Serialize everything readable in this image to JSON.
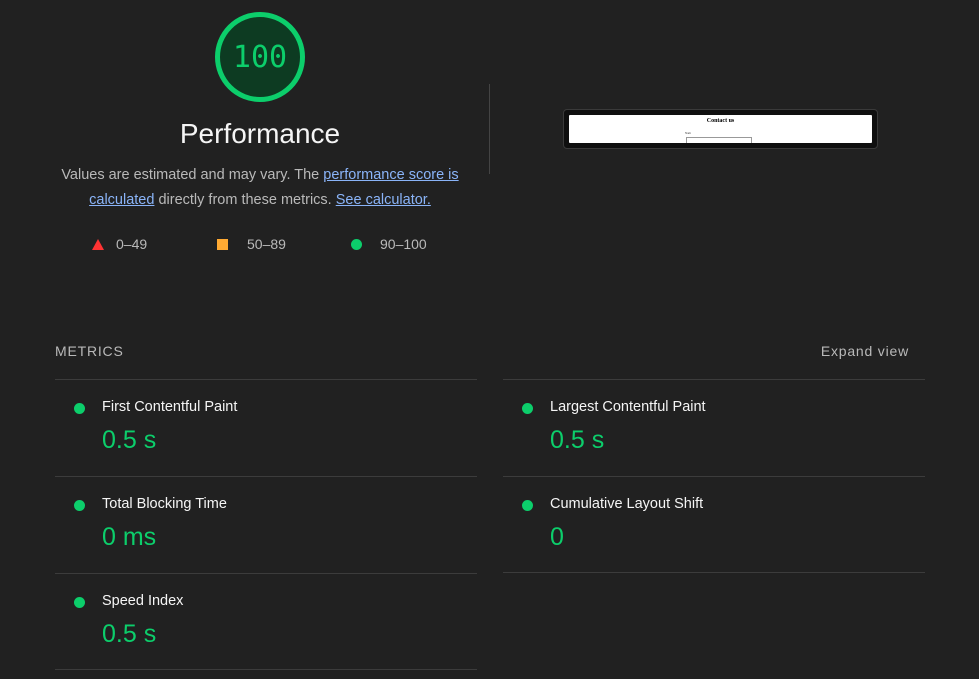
{
  "score": {
    "value": "100",
    "color": "#0cce6b"
  },
  "title": "Performance",
  "description": {
    "prefix": "Values are estimated and may vary. The ",
    "link1": "performance score is calculated",
    "middle": " directly from these metrics. ",
    "link2": "See calculator."
  },
  "legend": [
    {
      "icon": "triangle-icon",
      "label": "0–49",
      "color": "#ff3333"
    },
    {
      "icon": "square-icon",
      "label": "50–89",
      "color": "#ffaa33"
    },
    {
      "icon": "circle-icon",
      "label": "90–100",
      "color": "#0cce6b"
    }
  ],
  "thumbnail": {
    "title": "Contact us",
    "label": "Nam"
  },
  "metrics": {
    "heading": "METRICS",
    "expand_label": "Expand view",
    "items": [
      {
        "name": "First Contentful Paint",
        "value": "0.5 s"
      },
      {
        "name": "Largest Contentful Paint",
        "value": "0.5 s"
      },
      {
        "name": "Total Blocking Time",
        "value": "0 ms"
      },
      {
        "name": "Cumulative Layout Shift",
        "value": "0"
      },
      {
        "name": "Speed Index",
        "value": "0.5 s"
      }
    ]
  }
}
